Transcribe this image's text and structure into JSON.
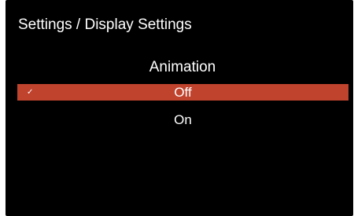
{
  "header": {
    "title": "Settings / Display Settings"
  },
  "menu": {
    "heading": "Animation",
    "selected_index": 0,
    "options": [
      {
        "label": "Off",
        "selected": true,
        "check_icon": "✓"
      },
      {
        "label": "On",
        "selected": false
      }
    ]
  },
  "colors": {
    "background": "#000000",
    "highlight": "#c0432e",
    "text": "#ffffff"
  }
}
